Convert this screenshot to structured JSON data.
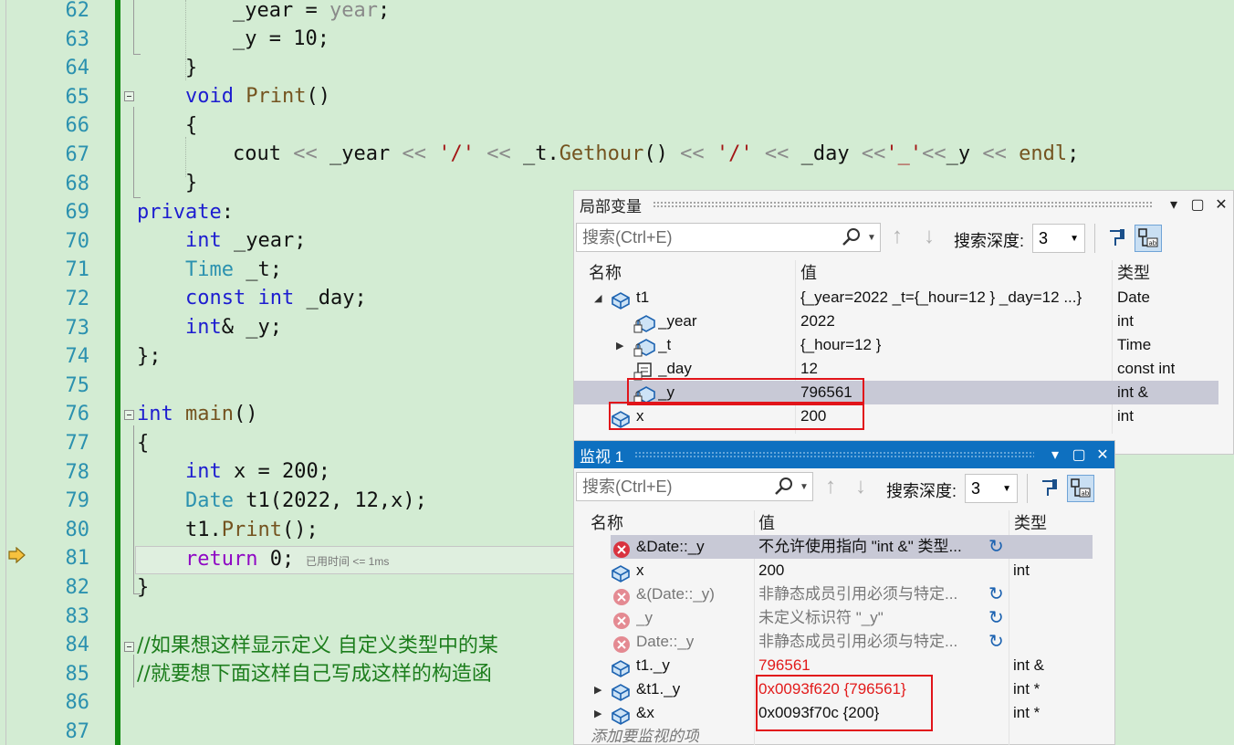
{
  "editor": {
    "lines": [
      {
        "n": "62"
      },
      {
        "n": "63"
      },
      {
        "n": "64"
      },
      {
        "n": "65"
      },
      {
        "n": "66"
      },
      {
        "n": "67"
      },
      {
        "n": "68"
      },
      {
        "n": "69"
      },
      {
        "n": "70"
      },
      {
        "n": "71"
      },
      {
        "n": "72"
      },
      {
        "n": "73"
      },
      {
        "n": "74"
      },
      {
        "n": "75"
      },
      {
        "n": "76"
      },
      {
        "n": "77"
      },
      {
        "n": "78"
      },
      {
        "n": "79"
      },
      {
        "n": "80"
      },
      {
        "n": "81"
      },
      {
        "n": "82"
      },
      {
        "n": "83"
      },
      {
        "n": "84"
      },
      {
        "n": "85"
      },
      {
        "n": "86"
      },
      {
        "n": "87"
      }
    ],
    "code": {
      "l62": {
        "a": "_year",
        "b": " = ",
        "c": "year",
        "d": ";"
      },
      "l63": {
        "a": "_y = 10;"
      },
      "l64": {
        "a": "}"
      },
      "l65": {
        "kw": "void",
        "fn": "Print",
        "rest": "()"
      },
      "l66": {
        "a": "{"
      },
      "l67": {
        "a": "cout ",
        "op1": "<<",
        "b": " _year ",
        "op2": "<<",
        "c": " ",
        "s1": "'/'",
        "d": " ",
        "op3": "<<",
        "e": " _t.",
        "fn": "Gethour",
        "f": "() ",
        "op4": "<<",
        "g": " ",
        "s2": "'/'",
        "h": " ",
        "op5": "<<",
        "i": " _day ",
        "op6": "<<",
        "s3": "'_'",
        "op7": "<<",
        "j": "_y ",
        "op8": "<<",
        "k": " ",
        "fn2": "endl",
        "l": ";"
      },
      "l68": {
        "a": "}"
      },
      "l69": {
        "kw": "private",
        "rest": ":"
      },
      "l70": {
        "kw": "int",
        "rest": " _year;"
      },
      "l71": {
        "ty": "Time",
        "rest": " _t;"
      },
      "l72": {
        "kw": "const",
        "sp": " ",
        "kw2": "int",
        "rest": " _day;"
      },
      "l73": {
        "kw": "int",
        "rest": "& _y;"
      },
      "l74": {
        "a": "};"
      },
      "l76": {
        "kw": "int",
        "sp": " ",
        "fn": "main",
        "rest": "()"
      },
      "l77": {
        "a": "{"
      },
      "l78": {
        "kw": "int",
        "rest": " x = 200;"
      },
      "l79": {
        "ty": "Date",
        "rest": " t1(2022, 12,x);"
      },
      "l80": {
        "a": "t1.",
        "fn": "Print",
        "rest": "();"
      },
      "l81": {
        "kw": "return",
        "rest": " 0;"
      },
      "l82": {
        "a": "}"
      },
      "l84": {
        "cm": "//如果想这样显示定义 自定义类型中的某"
      },
      "l85": {
        "cm": "//就要想下面这样自己写成这样的构造函"
      }
    },
    "elapsed_hint": "已用时间 <= 1ms"
  },
  "locals": {
    "title": "局部变量",
    "search_placeholder": "搜索(Ctrl+E)",
    "depth_label": "搜索深度:",
    "depth_value": "3",
    "columns": {
      "name": "名称",
      "value": "值",
      "type": "类型"
    },
    "rows": [
      {
        "name": "t1",
        "value": "{_year=2022 _t={_hour=12 } _day=12 ...}",
        "type": "Date"
      },
      {
        "name": "_year",
        "value": "2022",
        "type": "int"
      },
      {
        "name": "_t",
        "value": "{_hour=12 }",
        "type": "Time"
      },
      {
        "name": "_day",
        "value": "12",
        "type": "const int"
      },
      {
        "name": "_y",
        "value": "796561",
        "type": "int &"
      },
      {
        "name": "x",
        "value": "200",
        "type": "int"
      }
    ]
  },
  "watch": {
    "title": "监视 1",
    "search_placeholder": "搜索(Ctrl+E)",
    "depth_label": "搜索深度:",
    "depth_value": "3",
    "columns": {
      "name": "名称",
      "value": "值",
      "type": "类型"
    },
    "rows": [
      {
        "name": "&Date::_y",
        "value": "不允许使用指向 \"int &\" 类型...",
        "type": ""
      },
      {
        "name": "x",
        "value": "200",
        "type": "int"
      },
      {
        "name": "&(Date::_y)",
        "value": "非静态成员引用必须与特定...",
        "type": ""
      },
      {
        "name": "_y",
        "value": "未定义标识符 \"_y\"",
        "type": ""
      },
      {
        "name": "Date::_y",
        "value": "非静态成员引用必须与特定...",
        "type": ""
      },
      {
        "name": "t1._y",
        "value": "796561",
        "type": "int &"
      },
      {
        "name": "&t1._y",
        "value": "0x0093f620 {796561}",
        "type": "int *"
      },
      {
        "name": "&x",
        "value": "0x0093f70c {200}",
        "type": "int *"
      }
    ],
    "add_item": "添加要监视的项"
  },
  "colors": {
    "accent": "#0e70c0",
    "error": "#e21b1b",
    "highlight": "#e1141a",
    "editor_bg": "#d3ecd3"
  }
}
